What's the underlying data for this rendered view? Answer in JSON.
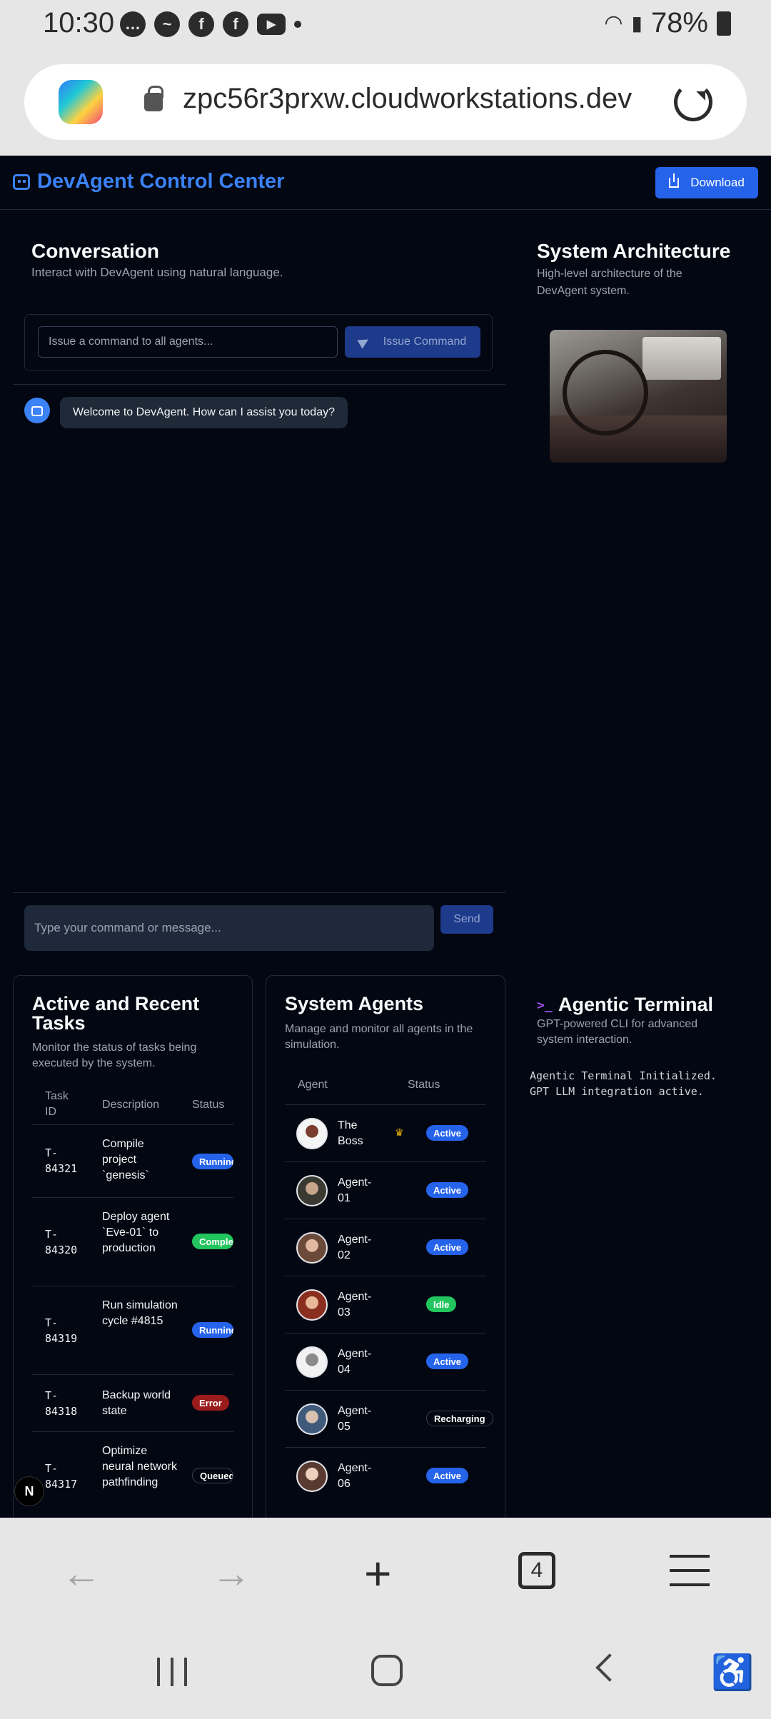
{
  "status_bar": {
    "time": "10:30",
    "battery": "78%",
    "notification_icons": [
      "chat-bubble-icon",
      "messenger-icon",
      "facebook-icon",
      "facebook-icon",
      "youtube-icon",
      "dot-icon"
    ]
  },
  "browser": {
    "url": "zpc56r3prxw.cloudworkstations.dev",
    "tab_count": "4"
  },
  "app": {
    "title": "DevAgent Control Center",
    "download_label": "Download",
    "accent_color": "#3b82f6"
  },
  "conversation": {
    "title": "Conversation",
    "subtitle": "Interact with DevAgent using natural language.",
    "command_placeholder": "Issue a command to all agents...",
    "issue_button": "Issue Command",
    "messages": [
      {
        "from": "bot",
        "text": "Welcome to DevAgent. How can I assist you today?"
      }
    ],
    "input_placeholder": "Type your command or message...",
    "send_label": "Send"
  },
  "architecture": {
    "title": "System Architecture",
    "subtitle": "High-level architecture of the DevAgent system."
  },
  "tasks": {
    "title": "Active and Recent Tasks",
    "subtitle": "Monitor the status of tasks being executed by the system.",
    "headers": [
      "Task ID",
      "Description",
      "Status"
    ],
    "rows": [
      {
        "id": "T-84321",
        "description": "Compile project `genesis`",
        "status": "Running"
      },
      {
        "id": "T-84320",
        "description": "Deploy agent `Eve-01` to production",
        "status": "Completed"
      },
      {
        "id": "T-84319",
        "description": "Run simulation cycle #4815",
        "status": "Running"
      },
      {
        "id": "T-84318",
        "description": "Backup world state",
        "status": "Error"
      },
      {
        "id": "T-84317",
        "description": "Optimize neural network pathfinding",
        "status": "Queued"
      }
    ]
  },
  "agents": {
    "title": "System Agents",
    "subtitle": "Manage and monitor all agents in the simulation.",
    "headers": [
      "Agent",
      "Status"
    ],
    "rows": [
      {
        "name": "The Boss",
        "status": "Active",
        "crown": true
      },
      {
        "name": "Agent-01",
        "status": "Active"
      },
      {
        "name": "Agent-02",
        "status": "Active"
      },
      {
        "name": "Agent-03",
        "status": "Idle"
      },
      {
        "name": "Agent-04",
        "status": "Active"
      },
      {
        "name": "Agent-05",
        "status": "Recharging"
      },
      {
        "name": "Agent-06",
        "status": "Active"
      }
    ]
  },
  "terminal": {
    "title": "Agentic Terminal",
    "subtitle": "GPT-powered CLI for advanced system interaction.",
    "output": "Agentic Terminal Initialized.\nGPT LLM integration active."
  },
  "status_colors": {
    "Running": "#2563eb",
    "Completed": "#22c55e",
    "Error": "#991b1b",
    "Queued": "#030712",
    "Active": "#2563eb",
    "Idle": "#22c55e",
    "Recharging": "#030712"
  },
  "dev_badge": "N"
}
